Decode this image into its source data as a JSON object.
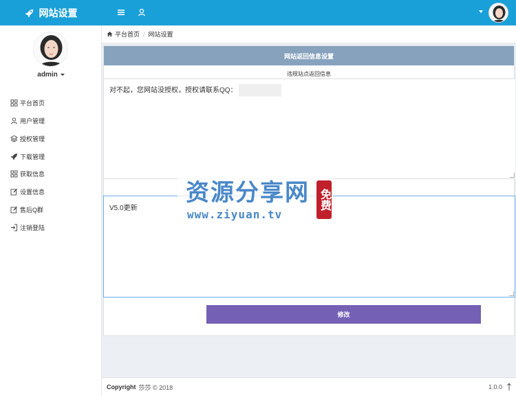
{
  "app": {
    "title": "网站设置",
    "brand_color": "#1aa0d8"
  },
  "topbar": {
    "icons": [
      "list-icon",
      "user-icon"
    ]
  },
  "sidebar": {
    "username": "admin",
    "items": [
      {
        "label": "平台首页",
        "icon": "grid-icon"
      },
      {
        "label": "用户管理",
        "icon": "user-icon"
      },
      {
        "label": "授权管理",
        "icon": "layers-icon"
      },
      {
        "label": "下载管理",
        "icon": "rocket-icon"
      },
      {
        "label": "获取信息",
        "icon": "grid-icon"
      },
      {
        "label": "设置信息",
        "icon": "edit-icon"
      },
      {
        "label": "售后Q群",
        "icon": "edit-icon"
      },
      {
        "label": "注销登陆",
        "icon": "logout-icon"
      }
    ]
  },
  "breadcrumb": {
    "home": "平台首页",
    "current": "网站设置"
  },
  "panel": {
    "heading": "网站返回信息设置",
    "subtitle": "违规站点返回信息",
    "message": "对不起，您网站没授权，授权请联系QQ：",
    "update_text": "V5.0更新",
    "submit_label": "修改",
    "header_color": "#86a2bd",
    "button_color": "#7460b4"
  },
  "watermark": {
    "title": "资源分享网",
    "url": "www.ziyuan.tv",
    "stamp": "免费"
  },
  "footer": {
    "copyright_label": "Copyright",
    "copyright_text": "莎莎 © 2018",
    "version": "1.0.0"
  }
}
